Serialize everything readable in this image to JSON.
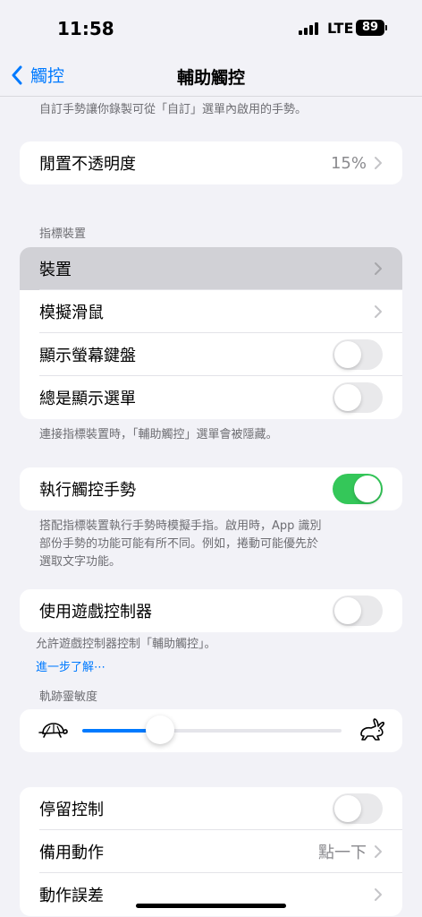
{
  "status": {
    "time": "11:58",
    "network": "LTE",
    "battery": "89"
  },
  "nav": {
    "back_label": "觸控",
    "title": "輔助觸控"
  },
  "top_note": "自訂手勢讓你錄製可從「自訂」選單內啟用的手勢。",
  "idle_opacity": {
    "label": "閒置不透明度",
    "value": "15%"
  },
  "pointer_devices": {
    "header": "指標裝置",
    "items": [
      {
        "label": "裝置",
        "type": "chevron"
      },
      {
        "label": "模擬滑鼠",
        "type": "chevron"
      },
      {
        "label": "顯示螢幕鍵盤",
        "type": "toggle",
        "on": false
      },
      {
        "label": "總是顯示選單",
        "type": "toggle",
        "on": false
      }
    ],
    "footer": "連接指標裝置時，「輔助觸控」選單會被隱藏。"
  },
  "perform_gestures": {
    "label": "執行觸控手勢",
    "on": true,
    "footer_lines": [
      "搭配指標裝置執行手勢時模擬手指。啟用時，App 識別",
      "部份手勢的功能可能有所不同。例如，捲動可能優先於",
      "選取文字功能。"
    ]
  },
  "game_controller": {
    "label": "使用遊戲控制器",
    "on": false,
    "footer": "允許遊戲控制器控制「輔助觸控」。",
    "learn_more": "進一步了解⋯"
  },
  "tracking_sensitivity": {
    "header": "軌跡靈敏度",
    "value": 0.3,
    "min_icon": "turtle-icon",
    "max_icon": "rabbit-icon"
  },
  "dwell": {
    "items": [
      {
        "label": "停留控制",
        "type": "toggle",
        "on": false
      },
      {
        "label": "備用動作",
        "type": "chevron",
        "value": "點一下"
      },
      {
        "label": "動作誤差",
        "type": "chevron"
      }
    ]
  },
  "colors": {
    "accent": "#007aff",
    "toggle_on": "#34c759",
    "toggle_off": "#e9e9eb",
    "background": "#f2f2f7"
  }
}
